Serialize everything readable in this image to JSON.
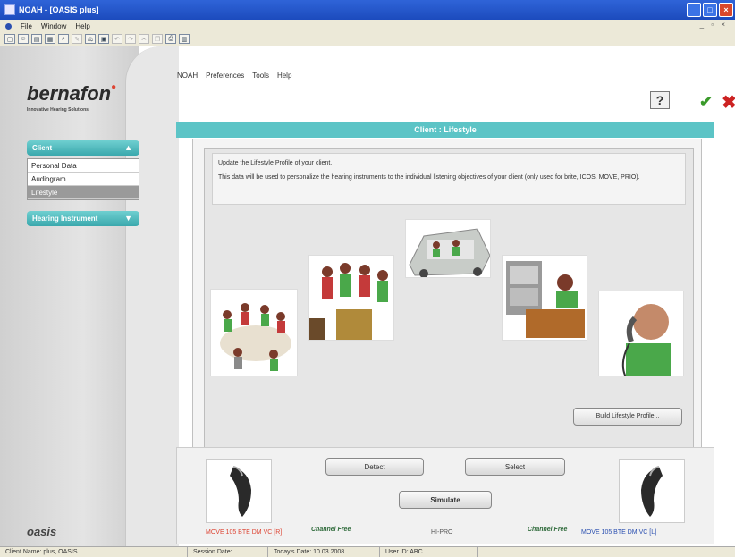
{
  "window": {
    "title": "NOAH - [OASIS plus]"
  },
  "outer_menu": {
    "items": [
      "File",
      "Window",
      "Help"
    ]
  },
  "app_menu": {
    "items": [
      "NOAH",
      "Preferences",
      "Tools",
      "Help"
    ]
  },
  "brand": {
    "logo": "bernafon",
    "tagline": "Innovative Hearing Solutions",
    "footer_logo": "oasis"
  },
  "header_buttons": {
    "help": "?"
  },
  "nav": {
    "client_header": "Client",
    "client_items": [
      "Personal Data",
      "Audiogram",
      "Lifestyle"
    ],
    "selected": "Lifestyle",
    "instruments_header": "Hearing Instrument"
  },
  "panel": {
    "title": "Client : Lifestyle",
    "intro": "Update the Lifestyle Profile of your client.",
    "description": "This data will be used to personalize the hearing instruments to the individual listening objectives of your client (only used for brite, ICOS, MOVE, PRIO).",
    "build_button": "Build Lifestyle Profile..."
  },
  "devices": {
    "detect": "Detect",
    "select": "Select",
    "simulate": "Simulate",
    "left_label": "MOVE 105 BTE DM VC",
    "left_side": "[R]",
    "right_label": "MOVE 105 BTE DM VC",
    "right_side": "[L]",
    "interface": "HI-PRO",
    "brand_left": "Channel Free",
    "brand_right": "Channel Free"
  },
  "status": {
    "client": "Client Name: plus, OASIS",
    "session": "Session Date:",
    "today": "Today's Date: 10.03.2008",
    "user": "User ID: ABC"
  },
  "colors": {
    "accent": "#5cc4c6",
    "titlebar": "#2f64d8"
  }
}
